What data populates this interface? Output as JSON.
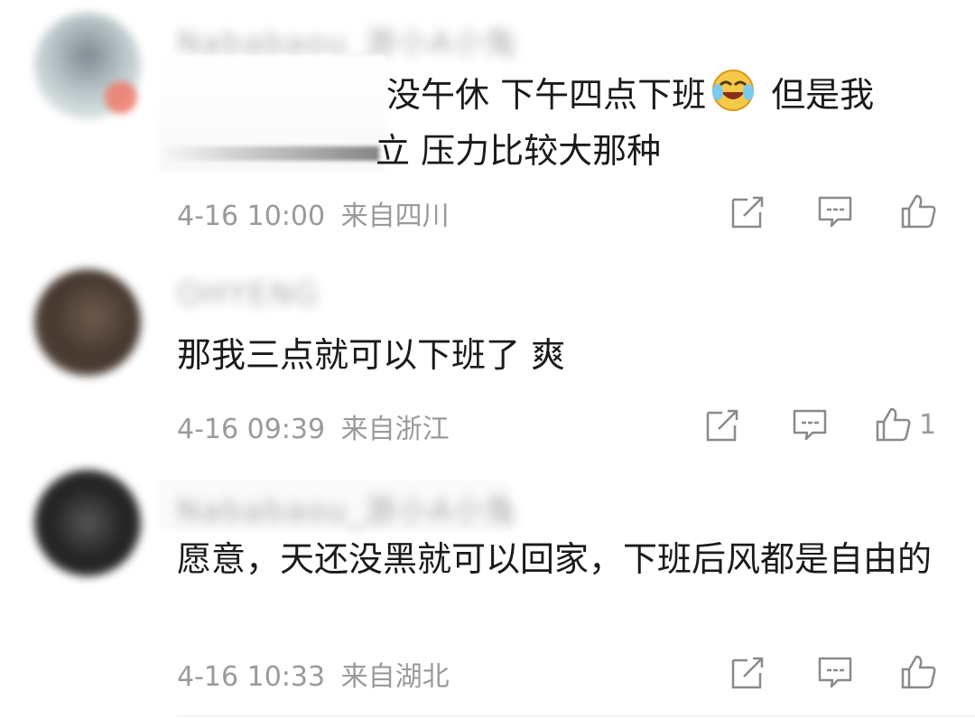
{
  "comments": [
    {
      "username": "Nababaou_游小A小兔",
      "text_line1": "没午休  下午四点下班",
      "text_line1_after_emoji": " 但是我",
      "text_line2": "立 压力比较大那种",
      "date": "4-16 10:00",
      "location": "来自四川",
      "likes": ""
    },
    {
      "username": "OHYENG",
      "text": "那我三点就可以下班了 爽",
      "date": "4-16 09:39",
      "location": "来自浙江",
      "likes": "1"
    },
    {
      "username": "Nababaou_游小A小兔",
      "text": "愿意，天还没黑就可以回家，下班后风都是自由的",
      "date": "4-16 10:33",
      "location": "来自湖北",
      "likes": ""
    }
  ],
  "icons": {
    "share": "share-icon",
    "reply": "comment-icon",
    "like": "thumbs-up-icon",
    "emoji": "laughing-crying-emoji-icon"
  }
}
